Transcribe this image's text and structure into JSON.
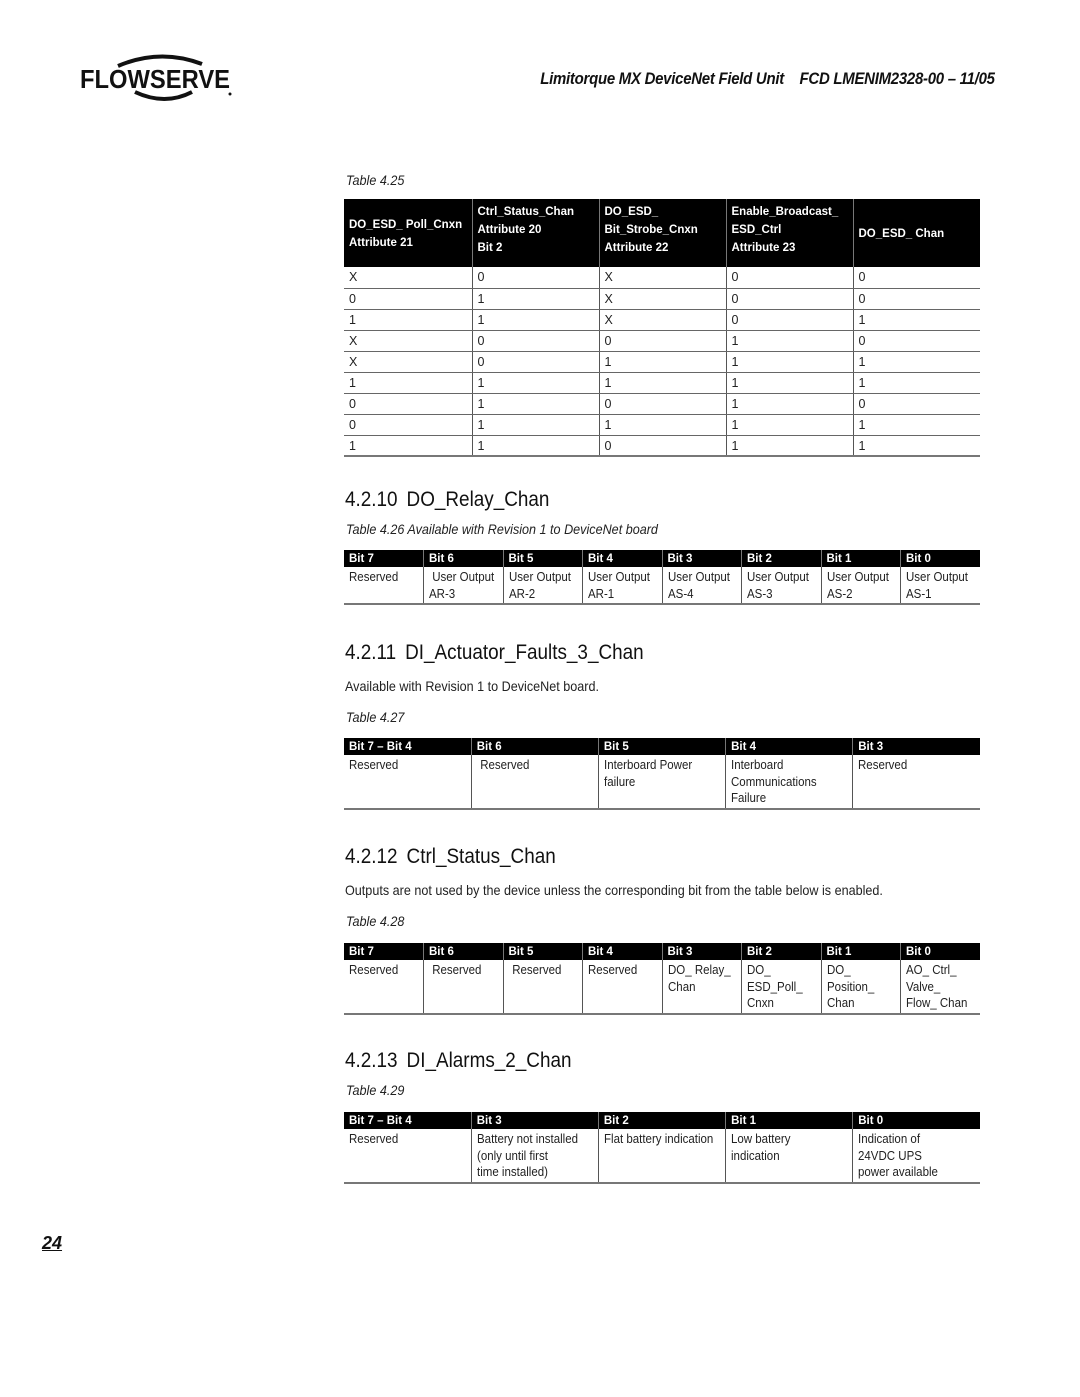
{
  "header": {
    "logo_text": "FLOWSERVE",
    "title": "Limitorque MX DeviceNet Field Unit    FCD LMENIM2328-00 – 11/05"
  },
  "table_4_25": {
    "caption": "Table 4.25",
    "headers": [
      {
        "line1": "DO_ESD_ Poll_Cnxn",
        "line2": "Attribute 21",
        "line3": ""
      },
      {
        "line1": "Ctrl_Status_Chan",
        "line2": "Attribute 20",
        "line3": "Bit 2"
      },
      {
        "line1": "DO_ESD_",
        "line2": "Bit_Strobe_Cnxn",
        "line3": "Attribute 22"
      },
      {
        "line1": "Enable_Broadcast_",
        "line2": "ESD_Ctrl",
        "line3": "Attribute 23"
      },
      {
        "line1": "DO_ESD_ Chan",
        "line2": "",
        "line3": ""
      }
    ],
    "rows": [
      [
        "X",
        "0",
        "X",
        "0",
        "0"
      ],
      [
        "0",
        "1",
        "X",
        "0",
        "0"
      ],
      [
        "1",
        "1",
        "X",
        "0",
        "1"
      ],
      [
        "X",
        "0",
        "0",
        "1",
        "0"
      ],
      [
        "X",
        "0",
        "1",
        "1",
        "1"
      ],
      [
        "1",
        "1",
        "1",
        "1",
        "1"
      ],
      [
        "0",
        "1",
        "0",
        "1",
        "0"
      ],
      [
        "0",
        "1",
        "1",
        "1",
        "1"
      ],
      [
        "1",
        "1",
        "0",
        "1",
        "1"
      ]
    ]
  },
  "section_4_2_10": {
    "number": "4.2.10",
    "title": "DO_Relay_Chan",
    "caption": "Table 4.26 Available with Revision 1 to DeviceNet board",
    "headers": [
      "Bit 7",
      "Bit 6",
      "Bit 5",
      "Bit 4",
      "Bit 3",
      "Bit 2",
      "Bit 1",
      "Bit 0"
    ],
    "cells": [
      [
        "Reserved",
        ""
      ],
      [
        " User Output",
        "AR-3"
      ],
      [
        "User Output",
        "AR-2"
      ],
      [
        "User Output",
        "AR-1"
      ],
      [
        "User Output",
        "AS-4"
      ],
      [
        "User Output",
        "AS-3"
      ],
      [
        "User Output",
        "AS-2"
      ],
      [
        "User Output",
        "AS-1"
      ]
    ]
  },
  "section_4_2_11": {
    "number": "4.2.11",
    "title": "DI_Actuator_Faults_3_Chan",
    "paragraph": "Available with Revision 1 to DeviceNet board.",
    "caption": "Table 4.27",
    "headers": [
      "Bit 7 – Bit 4",
      "Bit 6",
      "Bit 5",
      "Bit 4",
      "Bit 3"
    ],
    "cells": [
      [
        "Reserved",
        "",
        ""
      ],
      [
        " Reserved",
        "",
        ""
      ],
      [
        "Interboard Power",
        "failure",
        ""
      ],
      [
        "Interboard",
        "Communications",
        "Failure"
      ],
      [
        "Reserved",
        "",
        ""
      ]
    ]
  },
  "section_4_2_12": {
    "number": "4.2.12",
    "title": "Ctrl_Status_Chan",
    "paragraph": "Outputs are not used by the device unless the corresponding bit from the table below is enabled.",
    "caption": "Table 4.28",
    "headers": [
      "Bit 7",
      "Bit 6",
      "Bit 5",
      "Bit 4",
      "Bit 3",
      "Bit 2",
      "Bit 1",
      "Bit 0"
    ],
    "cells": [
      [
        "Reserved",
        "",
        ""
      ],
      [
        " Reserved",
        "",
        ""
      ],
      [
        " Reserved",
        "",
        ""
      ],
      [
        "Reserved",
        "",
        ""
      ],
      [
        "DO_ Relay_",
        "Chan",
        ""
      ],
      [
        "DO_",
        "ESD_Poll_",
        "Cnxn"
      ],
      [
        "DO_",
        "Position_",
        "Chan"
      ],
      [
        "AO_ Ctrl_",
        "Valve_",
        "Flow_ Chan"
      ]
    ]
  },
  "section_4_2_13": {
    "number": "4.2.13",
    "title": "DI_Alarms_2_Chan",
    "caption": "Table 4.29",
    "headers": [
      "Bit 7 – Bit 4",
      "Bit 3",
      "Bit 2",
      "Bit 1",
      "Bit 0"
    ],
    "cells": [
      [
        "Reserved",
        "",
        ""
      ],
      [
        "Battery not installed",
        "(only until first",
        "time installed)"
      ],
      [
        "Flat battery indication",
        "",
        ""
      ],
      [
        "Low battery",
        "indication",
        ""
      ],
      [
        "Indication of",
        "24VDC UPS",
        "power available"
      ]
    ]
  },
  "footer": {
    "page_number": "24"
  }
}
